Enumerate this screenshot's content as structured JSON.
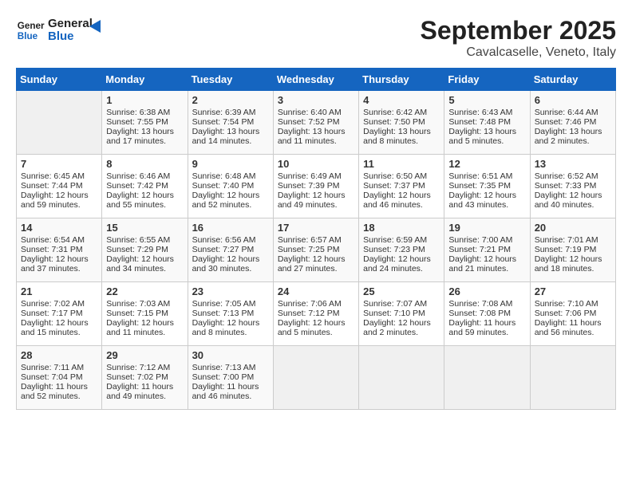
{
  "header": {
    "logo_line1": "General",
    "logo_line2": "Blue",
    "month": "September 2025",
    "location": "Cavalcaselle, Veneto, Italy"
  },
  "weekdays": [
    "Sunday",
    "Monday",
    "Tuesday",
    "Wednesday",
    "Thursday",
    "Friday",
    "Saturday"
  ],
  "weeks": [
    [
      {
        "day": "",
        "empty": true
      },
      {
        "day": "1",
        "sr": "6:38 AM",
        "ss": "7:55 PM",
        "dl": "13 hours and 17 minutes."
      },
      {
        "day": "2",
        "sr": "6:39 AM",
        "ss": "7:54 PM",
        "dl": "13 hours and 14 minutes."
      },
      {
        "day": "3",
        "sr": "6:40 AM",
        "ss": "7:52 PM",
        "dl": "13 hours and 11 minutes."
      },
      {
        "day": "4",
        "sr": "6:42 AM",
        "ss": "7:50 PM",
        "dl": "13 hours and 8 minutes."
      },
      {
        "day": "5",
        "sr": "6:43 AM",
        "ss": "7:48 PM",
        "dl": "13 hours and 5 minutes."
      },
      {
        "day": "6",
        "sr": "6:44 AM",
        "ss": "7:46 PM",
        "dl": "13 hours and 2 minutes."
      }
    ],
    [
      {
        "day": "7",
        "sr": "6:45 AM",
        "ss": "7:44 PM",
        "dl": "12 hours and 59 minutes."
      },
      {
        "day": "8",
        "sr": "6:46 AM",
        "ss": "7:42 PM",
        "dl": "12 hours and 55 minutes."
      },
      {
        "day": "9",
        "sr": "6:48 AM",
        "ss": "7:40 PM",
        "dl": "12 hours and 52 minutes."
      },
      {
        "day": "10",
        "sr": "6:49 AM",
        "ss": "7:39 PM",
        "dl": "12 hours and 49 minutes."
      },
      {
        "day": "11",
        "sr": "6:50 AM",
        "ss": "7:37 PM",
        "dl": "12 hours and 46 minutes."
      },
      {
        "day": "12",
        "sr": "6:51 AM",
        "ss": "7:35 PM",
        "dl": "12 hours and 43 minutes."
      },
      {
        "day": "13",
        "sr": "6:52 AM",
        "ss": "7:33 PM",
        "dl": "12 hours and 40 minutes."
      }
    ],
    [
      {
        "day": "14",
        "sr": "6:54 AM",
        "ss": "7:31 PM",
        "dl": "12 hours and 37 minutes."
      },
      {
        "day": "15",
        "sr": "6:55 AM",
        "ss": "7:29 PM",
        "dl": "12 hours and 34 minutes."
      },
      {
        "day": "16",
        "sr": "6:56 AM",
        "ss": "7:27 PM",
        "dl": "12 hours and 30 minutes."
      },
      {
        "day": "17",
        "sr": "6:57 AM",
        "ss": "7:25 PM",
        "dl": "12 hours and 27 minutes."
      },
      {
        "day": "18",
        "sr": "6:59 AM",
        "ss": "7:23 PM",
        "dl": "12 hours and 24 minutes."
      },
      {
        "day": "19",
        "sr": "7:00 AM",
        "ss": "7:21 PM",
        "dl": "12 hours and 21 minutes."
      },
      {
        "day": "20",
        "sr": "7:01 AM",
        "ss": "7:19 PM",
        "dl": "12 hours and 18 minutes."
      }
    ],
    [
      {
        "day": "21",
        "sr": "7:02 AM",
        "ss": "7:17 PM",
        "dl": "12 hours and 15 minutes."
      },
      {
        "day": "22",
        "sr": "7:03 AM",
        "ss": "7:15 PM",
        "dl": "12 hours and 11 minutes."
      },
      {
        "day": "23",
        "sr": "7:05 AM",
        "ss": "7:13 PM",
        "dl": "12 hours and 8 minutes."
      },
      {
        "day": "24",
        "sr": "7:06 AM",
        "ss": "7:12 PM",
        "dl": "12 hours and 5 minutes."
      },
      {
        "day": "25",
        "sr": "7:07 AM",
        "ss": "7:10 PM",
        "dl": "12 hours and 2 minutes."
      },
      {
        "day": "26",
        "sr": "7:08 AM",
        "ss": "7:08 PM",
        "dl": "11 hours and 59 minutes."
      },
      {
        "day": "27",
        "sr": "7:10 AM",
        "ss": "7:06 PM",
        "dl": "11 hours and 56 minutes."
      }
    ],
    [
      {
        "day": "28",
        "sr": "7:11 AM",
        "ss": "7:04 PM",
        "dl": "11 hours and 52 minutes."
      },
      {
        "day": "29",
        "sr": "7:12 AM",
        "ss": "7:02 PM",
        "dl": "11 hours and 49 minutes."
      },
      {
        "day": "30",
        "sr": "7:13 AM",
        "ss": "7:00 PM",
        "dl": "11 hours and 46 minutes."
      },
      {
        "day": "",
        "empty": true
      },
      {
        "day": "",
        "empty": true
      },
      {
        "day": "",
        "empty": true
      },
      {
        "day": "",
        "empty": true
      }
    ]
  ]
}
